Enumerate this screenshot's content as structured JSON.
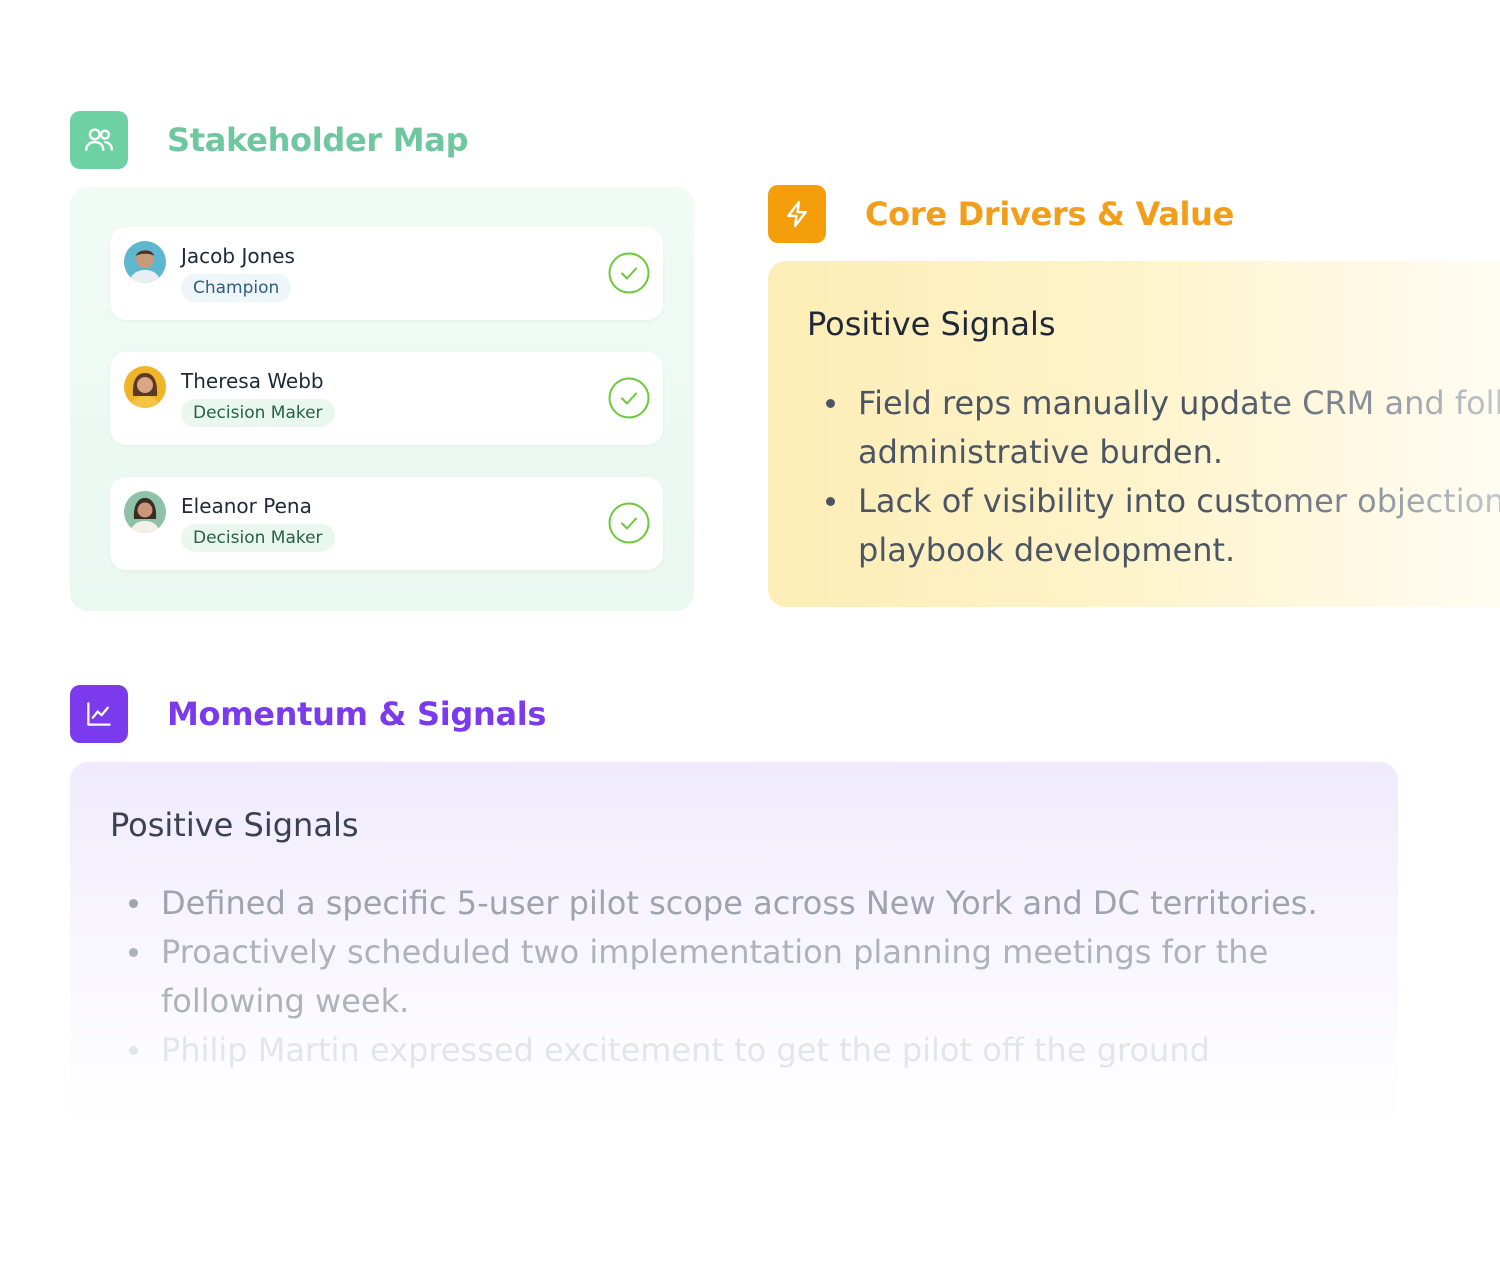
{
  "stakeholder_map": {
    "title": "Stakeholder Map",
    "icon": "users-icon",
    "accent": "#6ed1a4",
    "people": [
      {
        "name": "Jacob Jones",
        "role": "Champion",
        "verified": true
      },
      {
        "name": "Theresa Webb",
        "role": "Decision Maker",
        "verified": true
      },
      {
        "name": "Eleanor Pena",
        "role": "Decision Maker",
        "verified": true
      }
    ]
  },
  "core_drivers": {
    "title": "Core Drivers & Value",
    "icon": "lightning-icon",
    "accent": "#f59e0b",
    "heading": "Positive Signals",
    "bullets": [
      "Field reps manually update CRM and foll\nadministrative burden.",
      "Lack of visibility into customer objection\nplaybook development."
    ]
  },
  "momentum": {
    "title": "Momentum & Signals",
    "icon": "chart-line-icon",
    "accent": "#7c3aed",
    "heading": "Positive Signals",
    "bullets": [
      "Defined a specific 5-user pilot scope across New York and DC territories.",
      "Proactively scheduled two implementation planning meetings for the following week.",
      "Philip Martin expressed excitement to get the pilot off the ground"
    ]
  }
}
